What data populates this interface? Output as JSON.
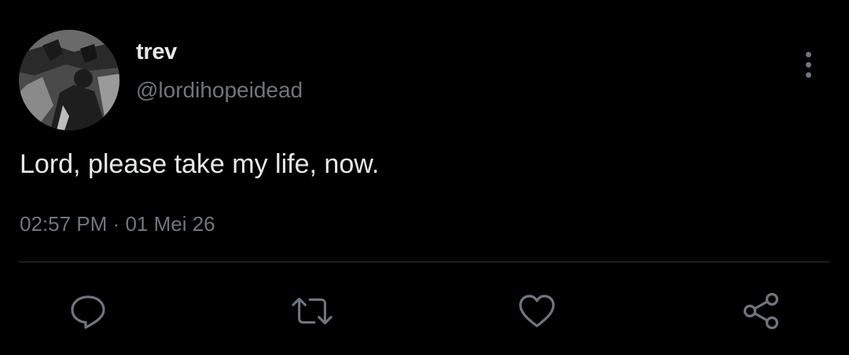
{
  "author": {
    "display_name": "trev",
    "handle": "@lordihopeidead"
  },
  "tweet": {
    "text": "Lord, please take my life, now.",
    "time": "02:57 PM",
    "separator": "·",
    "date": "01 Mei 26"
  },
  "actions": {
    "reply_icon": "speech-bubble-icon",
    "retweet_icon": "retweet-arrows-icon",
    "like_icon": "heart-icon",
    "share_icon": "share-nodes-icon"
  },
  "colors": {
    "background": "#000000",
    "primary_text": "#e7e9ea",
    "secondary_text": "#6e767d",
    "divider": "#2f3336"
  }
}
